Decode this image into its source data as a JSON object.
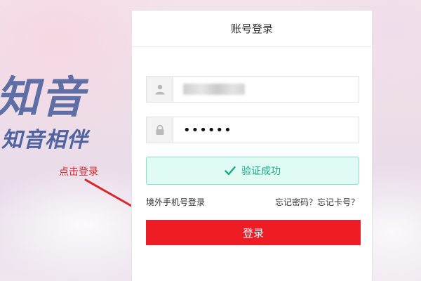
{
  "brand": {
    "logo_text": "知音",
    "slogan": "知音相伴"
  },
  "annotation": {
    "hint": "点击登录"
  },
  "login": {
    "title": "账号登录",
    "username_icon": "user-icon",
    "password_icon": "lock-icon",
    "password_value": "••••••",
    "verify_text": "验证成功",
    "overseas_login": "境外手机号登录",
    "forgot_links": "忘记密码？忘记卡号？",
    "submit_label": "登录"
  },
  "colors": {
    "primary": "#ee1c25",
    "verify_bg": "#dffbf3",
    "verify_text": "#1aa985",
    "brand": "#5f6fa6",
    "hint": "#d8262a"
  }
}
